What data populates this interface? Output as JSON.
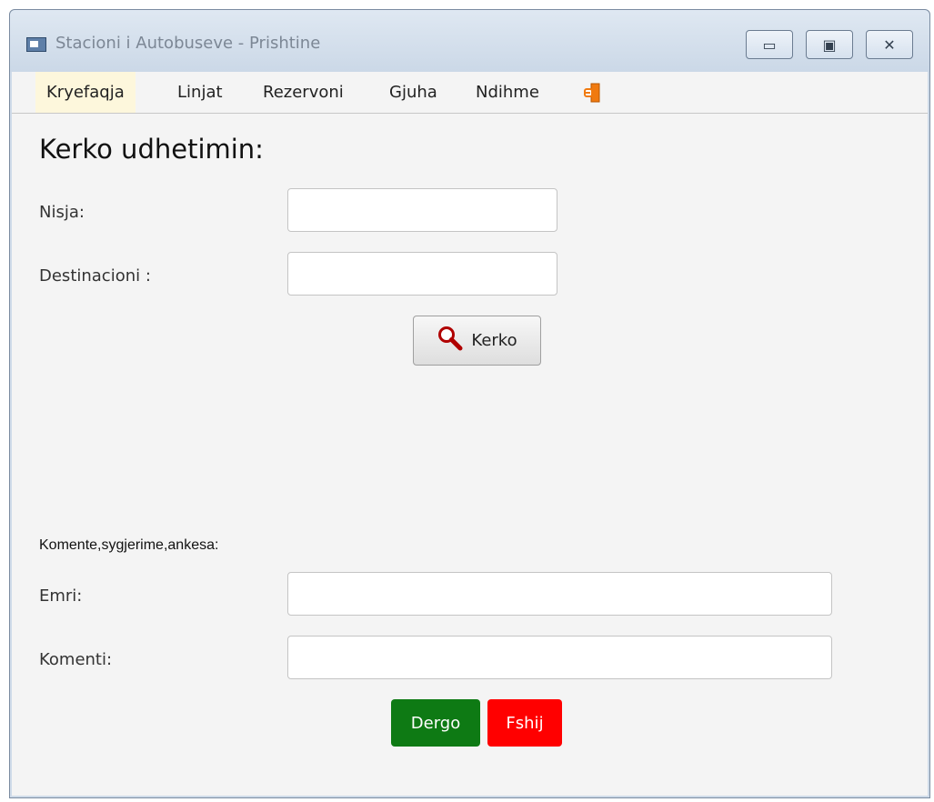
{
  "window": {
    "title": "Stacioni i Autobuseve - Prishtine",
    "controls": {
      "minimize_icon": "minimize-icon",
      "maximize_icon": "maximize-icon",
      "close_icon": "close-icon"
    }
  },
  "menu": {
    "items": [
      {
        "label": "Kryefaqja",
        "active": true
      },
      {
        "label": "Linjat"
      },
      {
        "label": "Rezervoni"
      },
      {
        "label": "Gjuha"
      },
      {
        "label": "Ndihme"
      }
    ],
    "exit_icon": "exit-door-icon"
  },
  "search": {
    "heading": "Kerko udhetimin:",
    "departure_label": "Nisja:",
    "departure_value": "",
    "destination_label": "Destinacioni :",
    "destination_value": "",
    "button_label": "Kerko",
    "button_icon": "magnifier-icon"
  },
  "feedback": {
    "heading": "Komente,sygjerime,ankesa:",
    "name_label": "Emri:",
    "name_value": "",
    "comment_label": "Komenti:",
    "comment_value": "",
    "send_label": "Dergo",
    "clear_label": "Fshij"
  },
  "colors": {
    "send_button": "#0e7a14",
    "clear_button": "#ff0000",
    "active_menu": "#fdf7dc",
    "search_icon": "#b00000",
    "exit_icon": "#f07a10"
  }
}
